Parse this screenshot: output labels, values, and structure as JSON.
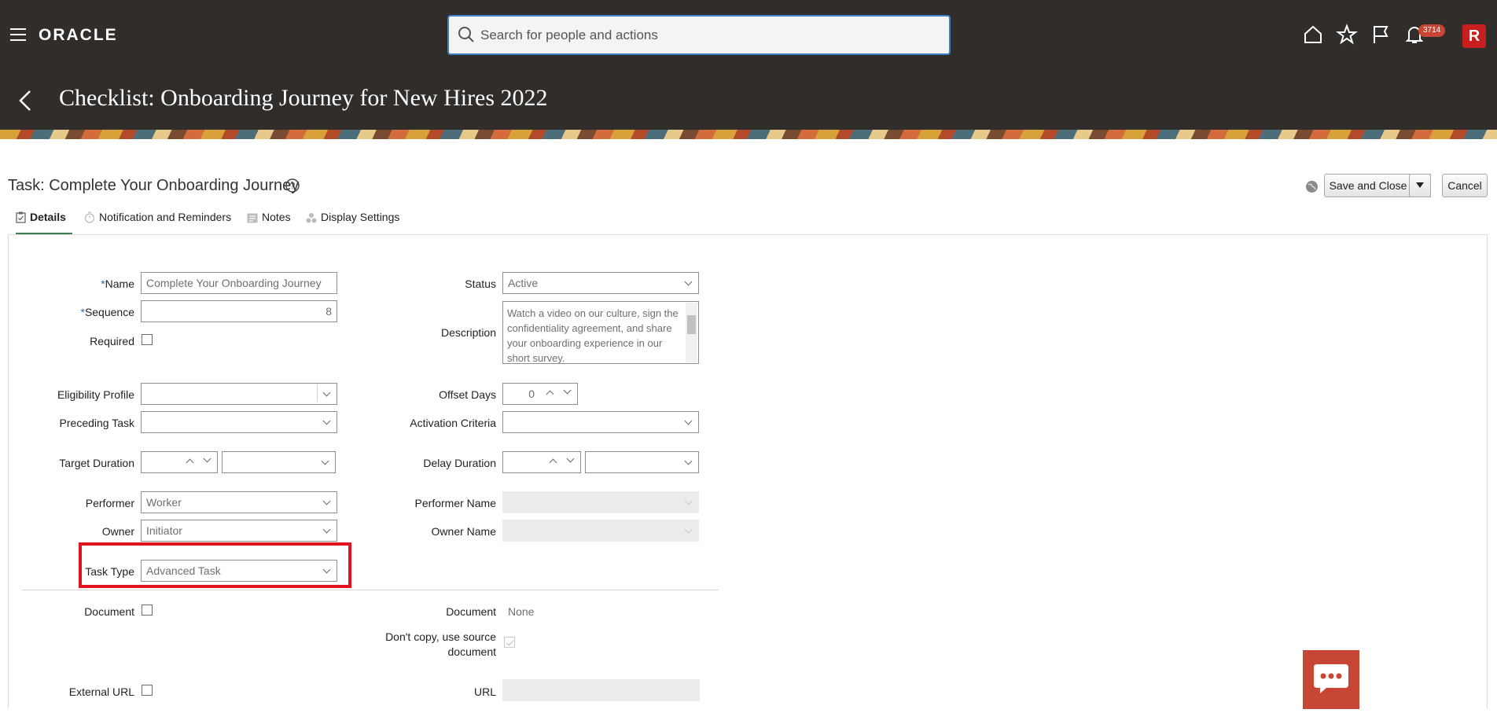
{
  "header": {
    "logo": "ORACLE",
    "search_placeholder": "Search for people and actions",
    "notification_count": "3714",
    "page_title": "Checklist: Onboarding Journey for New Hires 2022"
  },
  "task": {
    "title": "Task: Complete Your Onboarding Journey",
    "save_label": "Save and Close",
    "cancel_label": "Cancel"
  },
  "tabs": [
    {
      "label": "Details",
      "active": true
    },
    {
      "label": "Notification and Reminders",
      "active": false
    },
    {
      "label": "Notes",
      "active": false
    },
    {
      "label": "Display Settings",
      "active": false
    }
  ],
  "form": {
    "name": {
      "label": "Name",
      "required": "*",
      "value": "Complete Your Onboarding Journey"
    },
    "sequence": {
      "label": "Sequence",
      "required": "*",
      "value": "8"
    },
    "required": {
      "label": "Required"
    },
    "status": {
      "label": "Status",
      "value": "Active"
    },
    "description": {
      "label": "Description",
      "value": "Watch a video on our culture, sign the confidentiality agreement, and share your onboarding experience in our short survey."
    },
    "eligibility_profile": {
      "label": "Eligibility Profile",
      "value": ""
    },
    "preceding_task": {
      "label": "Preceding Task",
      "value": ""
    },
    "offset_days": {
      "label": "Offset Days",
      "value": "0"
    },
    "activation_criteria": {
      "label": "Activation Criteria",
      "value": ""
    },
    "target_duration": {
      "label": "Target Duration",
      "value": "",
      "unit": ""
    },
    "delay_duration": {
      "label": "Delay Duration",
      "value": "",
      "unit": ""
    },
    "performer": {
      "label": "Performer",
      "value": "Worker"
    },
    "owner": {
      "label": "Owner",
      "value": "Initiator"
    },
    "performer_name": {
      "label": "Performer Name",
      "value": ""
    },
    "owner_name": {
      "label": "Owner Name",
      "value": ""
    },
    "task_type": {
      "label": "Task Type",
      "value": "Advanced Task"
    },
    "document_check": {
      "label": "Document"
    },
    "document_value": {
      "label": "Document",
      "value": "None"
    },
    "dont_copy": {
      "label_line1": "Don't copy, use source",
      "label_line2": "document"
    },
    "external_url": {
      "label": "External URL"
    },
    "url": {
      "label": "URL",
      "value": ""
    }
  },
  "colors": {
    "accent": "#3b7ec6",
    "highlight": "#e0141e",
    "brand": "#c74634",
    "bar": "#312d2a"
  }
}
